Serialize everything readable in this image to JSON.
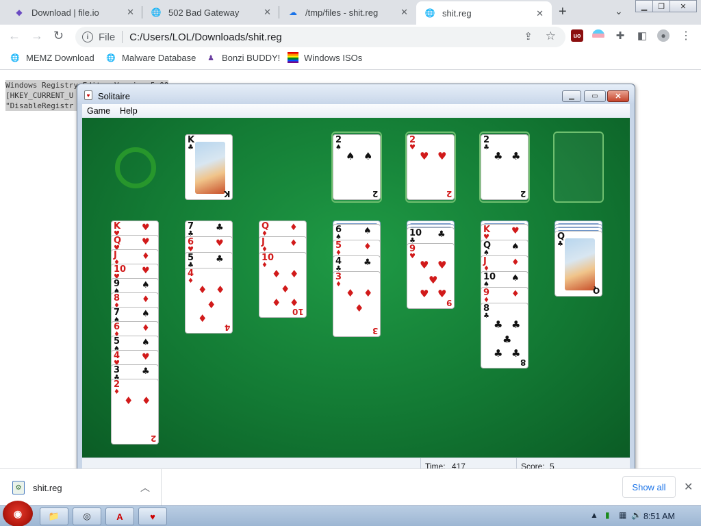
{
  "browser": {
    "tabs": [
      {
        "title": "Download | file.io",
        "favicon": "file-io-icon"
      },
      {
        "title": "502 Bad Gateway",
        "favicon": "globe-icon"
      },
      {
        "title": "/tmp/files - shit.reg",
        "favicon": "cloud-upload-icon"
      },
      {
        "title": "shit.reg",
        "favicon": "globe-icon"
      }
    ],
    "address": {
      "scheme_label": "File",
      "url": "C:/Users/LOL/Downloads/shit.reg"
    },
    "bookmarks": [
      {
        "label": "MEMZ Download",
        "icon": "globe-icon"
      },
      {
        "label": "Malware Database",
        "icon": "globe-icon"
      },
      {
        "label": "Bonzi BUDDY!",
        "icon": "bonzi-icon"
      },
      {
        "label": "Windows ISOs",
        "icon": "windows-flag-icon"
      }
    ]
  },
  "page": {
    "lines": [
      "Windows Registry Editor Version 5.00",
      "[HKEY_CURRENT_U",
      "\"DisableRegistr"
    ]
  },
  "solitaire": {
    "title": "Solitaire",
    "menu": [
      "Game",
      "Help"
    ],
    "status": {
      "time_label": "Time:",
      "time_value": "417",
      "score_label": "Score:",
      "score_value": "5"
    },
    "waste_card": "K♣",
    "foundations": [
      "2♠",
      "2♥",
      "2♣",
      ""
    ],
    "tableau": [
      [
        "K♥",
        "Q♥",
        "J♦",
        "10♥",
        "9♠",
        "8♦",
        "7♠",
        "6♦",
        "5♠",
        "4♥",
        "3♣",
        "2♦"
      ],
      [
        "7♣",
        "6♥",
        "5♣",
        "4♦"
      ],
      [
        "Q♦",
        "J♦",
        "10♦"
      ],
      [
        "6♠",
        "5♦",
        "4♣",
        "3♦"
      ],
      [
        "10♣",
        "9♥"
      ],
      [
        "K♥",
        "Q♠",
        "J♦",
        "10♠",
        "9♦",
        "8♣"
      ],
      [
        "Q♣"
      ]
    ]
  },
  "downloads": {
    "file_name": "shit.reg",
    "show_all": "Show all"
  },
  "taskbar": {
    "clock": "8:51 AM"
  }
}
